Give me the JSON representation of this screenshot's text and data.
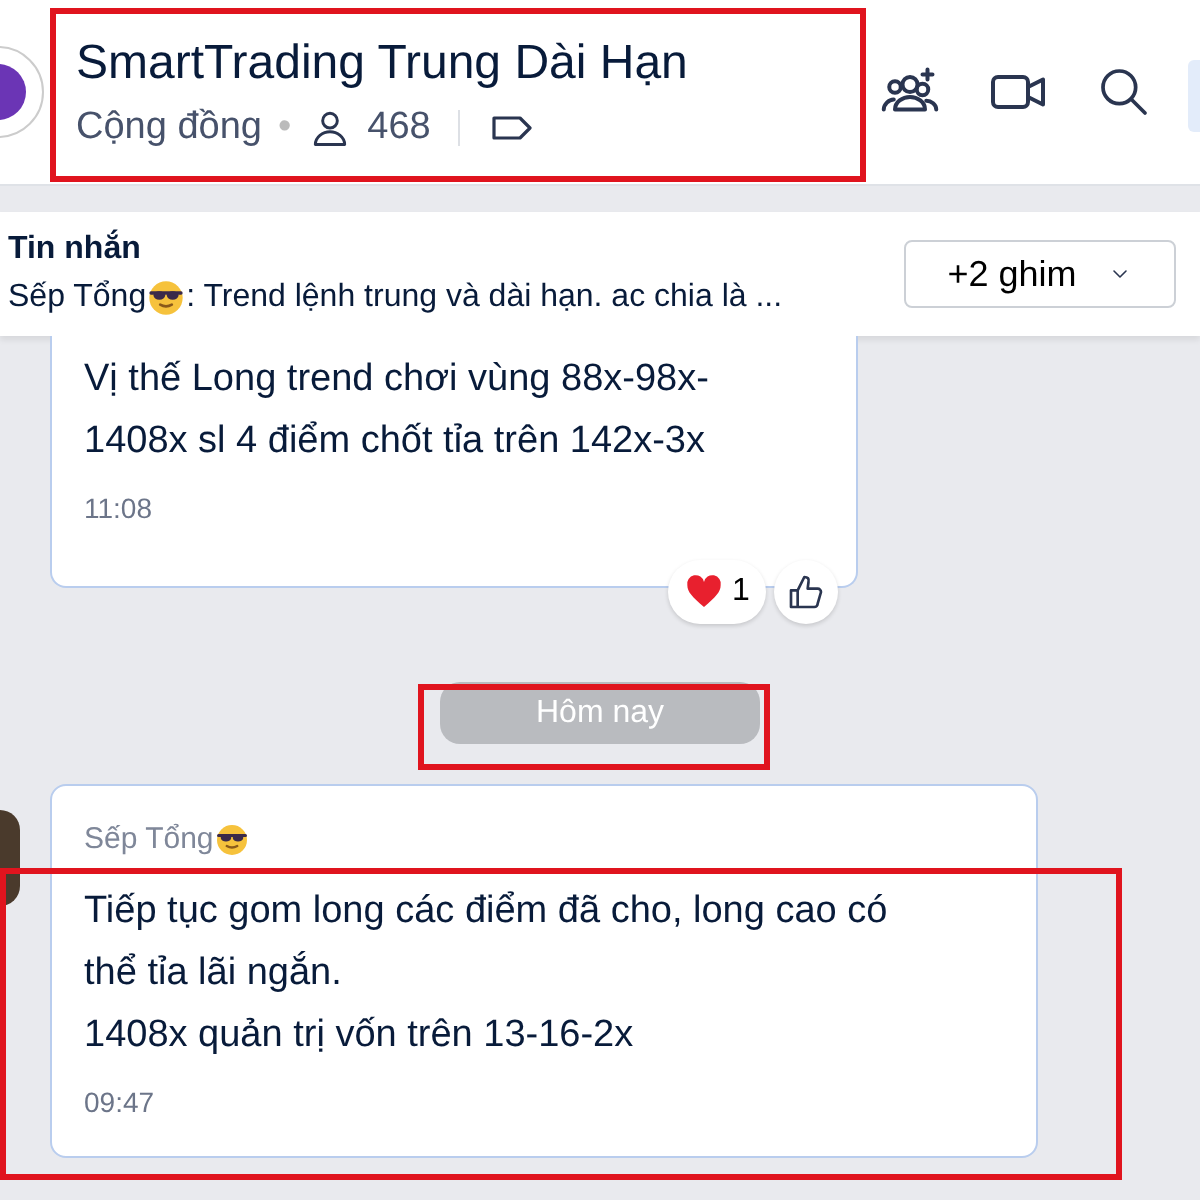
{
  "header": {
    "title": "SmartTrading Trung Dài Hạn",
    "type": "Cộng đồng",
    "separator": "•",
    "members": "468",
    "highlighted": true
  },
  "pinned": {
    "label": "Tin nhắn",
    "sender": "Sếp Tổng",
    "preview": ": Trend lệnh trung và dài hạn. ac chia là ...",
    "more": "+2 ghim"
  },
  "first_message": {
    "lines": [
      "Vị thế Long trend chơi vùng 88x-98x-",
      "1408x sl 4 điểm chốt tỉa trên 142x-3x"
    ],
    "time": "11:08",
    "reactions": [
      {
        "kind": "heart",
        "count": "1"
      },
      {
        "kind": "like"
      }
    ]
  },
  "date_divider": {
    "label": "Hôm nay",
    "highlighted": true
  },
  "last_message": {
    "sender": "Sếp Tổng",
    "lines": [
      "Tiếp tục gom long các điểm đã cho, long cao có",
      "thể tỉa lãi ngắn.",
      "1408x quản trị vốn trên 13-16-2x"
    ],
    "time": "09:47",
    "highlighted": true
  }
}
